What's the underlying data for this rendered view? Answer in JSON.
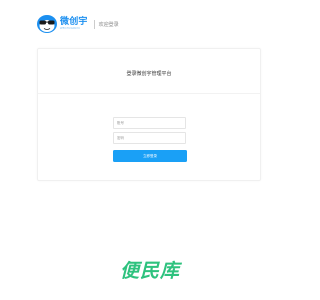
{
  "header": {
    "logo_name": "微创宇",
    "logo_sub": "WEICHUANGYU",
    "title": "欢迎登录",
    "logo_icon": "mascot-icon"
  },
  "login": {
    "title": "登录微创宇管理平台",
    "account_placeholder": "账号",
    "password_placeholder": "密码",
    "submit_label": "立即登录"
  },
  "footer": {
    "brand": "便民库"
  },
  "colors": {
    "accent": "#1aa0f6",
    "brand_green": "#2ec27e",
    "logo_blue": "#1b8ff0"
  }
}
